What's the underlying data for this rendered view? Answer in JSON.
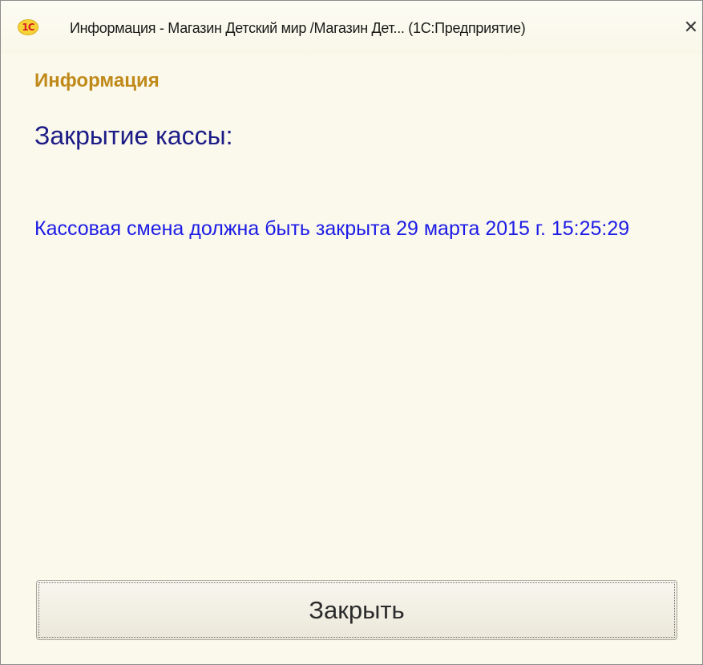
{
  "window": {
    "title": "Информация - Магазин Детский мир /Магазин Дет...  (1С:Предприятие)",
    "logo_text": "1C",
    "close_glyph": "✕"
  },
  "content": {
    "section_title": "Информация",
    "heading": "Закрытие кассы:",
    "message": "Кассовая смена должна быть закрыта 29 марта 2015 г. 15:25:29"
  },
  "actions": {
    "close_label": "Закрыть"
  },
  "colors": {
    "background": "#fbf9ec",
    "section_title": "#c08a1b",
    "heading": "#1c1c86",
    "message": "#1c1ce6"
  }
}
